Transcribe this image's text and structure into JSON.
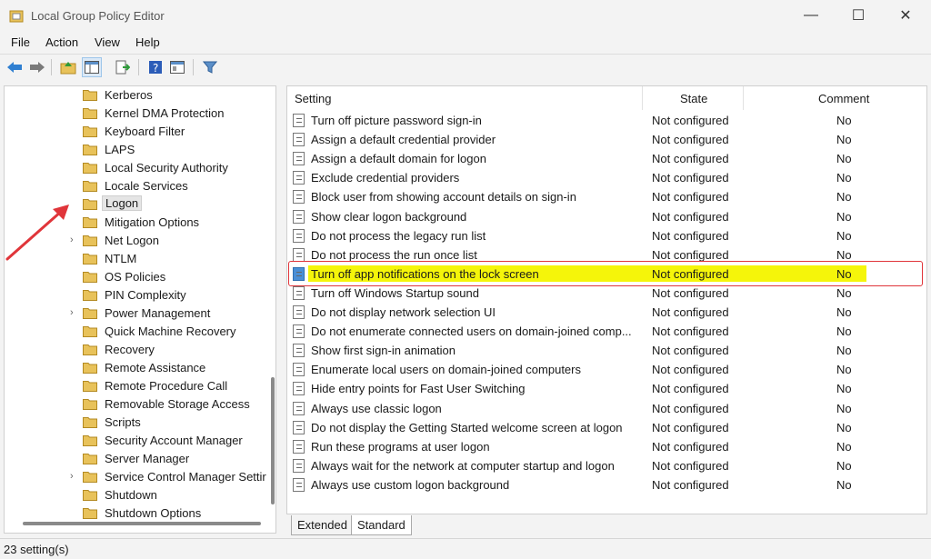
{
  "window": {
    "title": "Local Group Policy Editor",
    "minimize": "—",
    "maximize": "☐",
    "close": "✕"
  },
  "menu": [
    "File",
    "Action",
    "View",
    "Help"
  ],
  "tree": [
    {
      "label": "Kerberos",
      "expandable": false,
      "selected": false
    },
    {
      "label": "Kernel DMA Protection",
      "expandable": false,
      "selected": false
    },
    {
      "label": "Keyboard Filter",
      "expandable": false,
      "selected": false
    },
    {
      "label": "LAPS",
      "expandable": false,
      "selected": false
    },
    {
      "label": "Local Security Authority",
      "expandable": false,
      "selected": false
    },
    {
      "label": "Locale Services",
      "expandable": false,
      "selected": false
    },
    {
      "label": "Logon",
      "expandable": false,
      "selected": true
    },
    {
      "label": "Mitigation Options",
      "expandable": false,
      "selected": false
    },
    {
      "label": "Net Logon",
      "expandable": true,
      "selected": false
    },
    {
      "label": "NTLM",
      "expandable": false,
      "selected": false
    },
    {
      "label": "OS Policies",
      "expandable": false,
      "selected": false
    },
    {
      "label": "PIN Complexity",
      "expandable": false,
      "selected": false
    },
    {
      "label": "Power Management",
      "expandable": true,
      "selected": false
    },
    {
      "label": "Quick Machine Recovery",
      "expandable": false,
      "selected": false
    },
    {
      "label": "Recovery",
      "expandable": false,
      "selected": false
    },
    {
      "label": "Remote Assistance",
      "expandable": false,
      "selected": false
    },
    {
      "label": "Remote Procedure Call",
      "expandable": false,
      "selected": false
    },
    {
      "label": "Removable Storage Access",
      "expandable": false,
      "selected": false
    },
    {
      "label": "Scripts",
      "expandable": false,
      "selected": false
    },
    {
      "label": "Security Account Manager",
      "expandable": false,
      "selected": false
    },
    {
      "label": "Server Manager",
      "expandable": false,
      "selected": false
    },
    {
      "label": "Service Control Manager Settir",
      "expandable": true,
      "selected": false
    },
    {
      "label": "Shutdown",
      "expandable": false,
      "selected": false
    },
    {
      "label": "Shutdown Options",
      "expandable": false,
      "selected": false
    }
  ],
  "table": {
    "columns": {
      "setting": "Setting",
      "state": "State",
      "comment": "Comment"
    },
    "rows": [
      {
        "setting": "Turn off picture password sign-in",
        "state": "Not configured",
        "comment": "No"
      },
      {
        "setting": "Assign a default credential provider",
        "state": "Not configured",
        "comment": "No"
      },
      {
        "setting": "Assign a default domain for logon",
        "state": "Not configured",
        "comment": "No"
      },
      {
        "setting": "Exclude credential providers",
        "state": "Not configured",
        "comment": "No"
      },
      {
        "setting": "Block user from showing account details on sign-in",
        "state": "Not configured",
        "comment": "No"
      },
      {
        "setting": "Show clear logon background",
        "state": "Not configured",
        "comment": "No"
      },
      {
        "setting": "Do not process the legacy run list",
        "state": "Not configured",
        "comment": "No"
      },
      {
        "setting": "Do not process the run once list",
        "state": "Not configured",
        "comment": "No"
      },
      {
        "setting": "Turn off app notifications on the lock screen",
        "state": "Not configured",
        "comment": "No",
        "highlight": true
      },
      {
        "setting": "Turn off Windows Startup sound",
        "state": "Not configured",
        "comment": "No"
      },
      {
        "setting": "Do not display network selection UI",
        "state": "Not configured",
        "comment": "No"
      },
      {
        "setting": "Do not enumerate connected users on domain-joined comp...",
        "state": "Not configured",
        "comment": "No"
      },
      {
        "setting": "Show first sign-in animation",
        "state": "Not configured",
        "comment": "No"
      },
      {
        "setting": "Enumerate local users on domain-joined computers",
        "state": "Not configured",
        "comment": "No"
      },
      {
        "setting": "Hide entry points for Fast User Switching",
        "state": "Not configured",
        "comment": "No"
      },
      {
        "setting": "Always use classic logon",
        "state": "Not configured",
        "comment": "No"
      },
      {
        "setting": "Do not display the Getting Started welcome screen at logon",
        "state": "Not configured",
        "comment": "No"
      },
      {
        "setting": "Run these programs at user logon",
        "state": "Not configured",
        "comment": "No"
      },
      {
        "setting": "Always wait for the network at computer startup and logon",
        "state": "Not configured",
        "comment": "No"
      },
      {
        "setting": "Always use custom logon background",
        "state": "Not configured",
        "comment": "No"
      }
    ]
  },
  "tabs": [
    "Extended",
    "Standard"
  ],
  "active_tab": "Standard",
  "status": "23 setting(s)",
  "colors": {
    "highlight": "#f5f50a",
    "annotation": "#e0353a",
    "folder": "#e8c25a",
    "accent": "#2f7fd1"
  }
}
